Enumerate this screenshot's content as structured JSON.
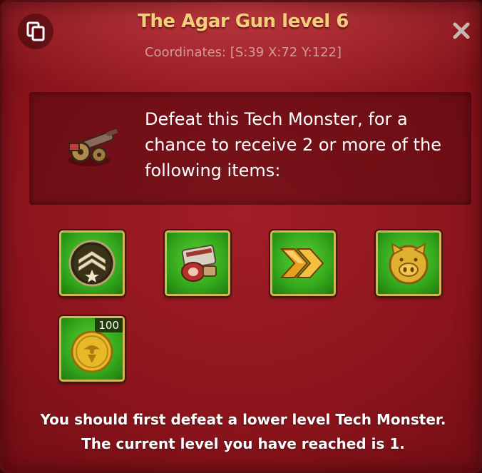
{
  "header": {
    "title": "The Agar Gun level 6",
    "coordinates": "Coordinates: [S:39  X:72  Y:122]",
    "copy_icon": "copy-icon",
    "close_icon": "close-icon"
  },
  "info": {
    "monster_icon": "agar-gun-icon",
    "message": "Defeat this Tech Monster, for a chance to receive 2 or more of the following items:"
  },
  "rewards": [
    {
      "icon": "rank-chevron-icon"
    },
    {
      "icon": "food-meat-icon"
    },
    {
      "icon": "speedup-arrows-icon"
    },
    {
      "icon": "pig-coin-icon"
    },
    {
      "icon": "gold-coin-icon",
      "quantity": "100"
    }
  ],
  "footer": {
    "line1": "You should first defeat a lower level Tech Monster.",
    "line2": "The current level you have reached is 1."
  },
  "colors": {
    "panel": "#8c141c",
    "title": "#f2d07a",
    "item_bg": "#34a81c",
    "item_border": "#d6b25a"
  }
}
